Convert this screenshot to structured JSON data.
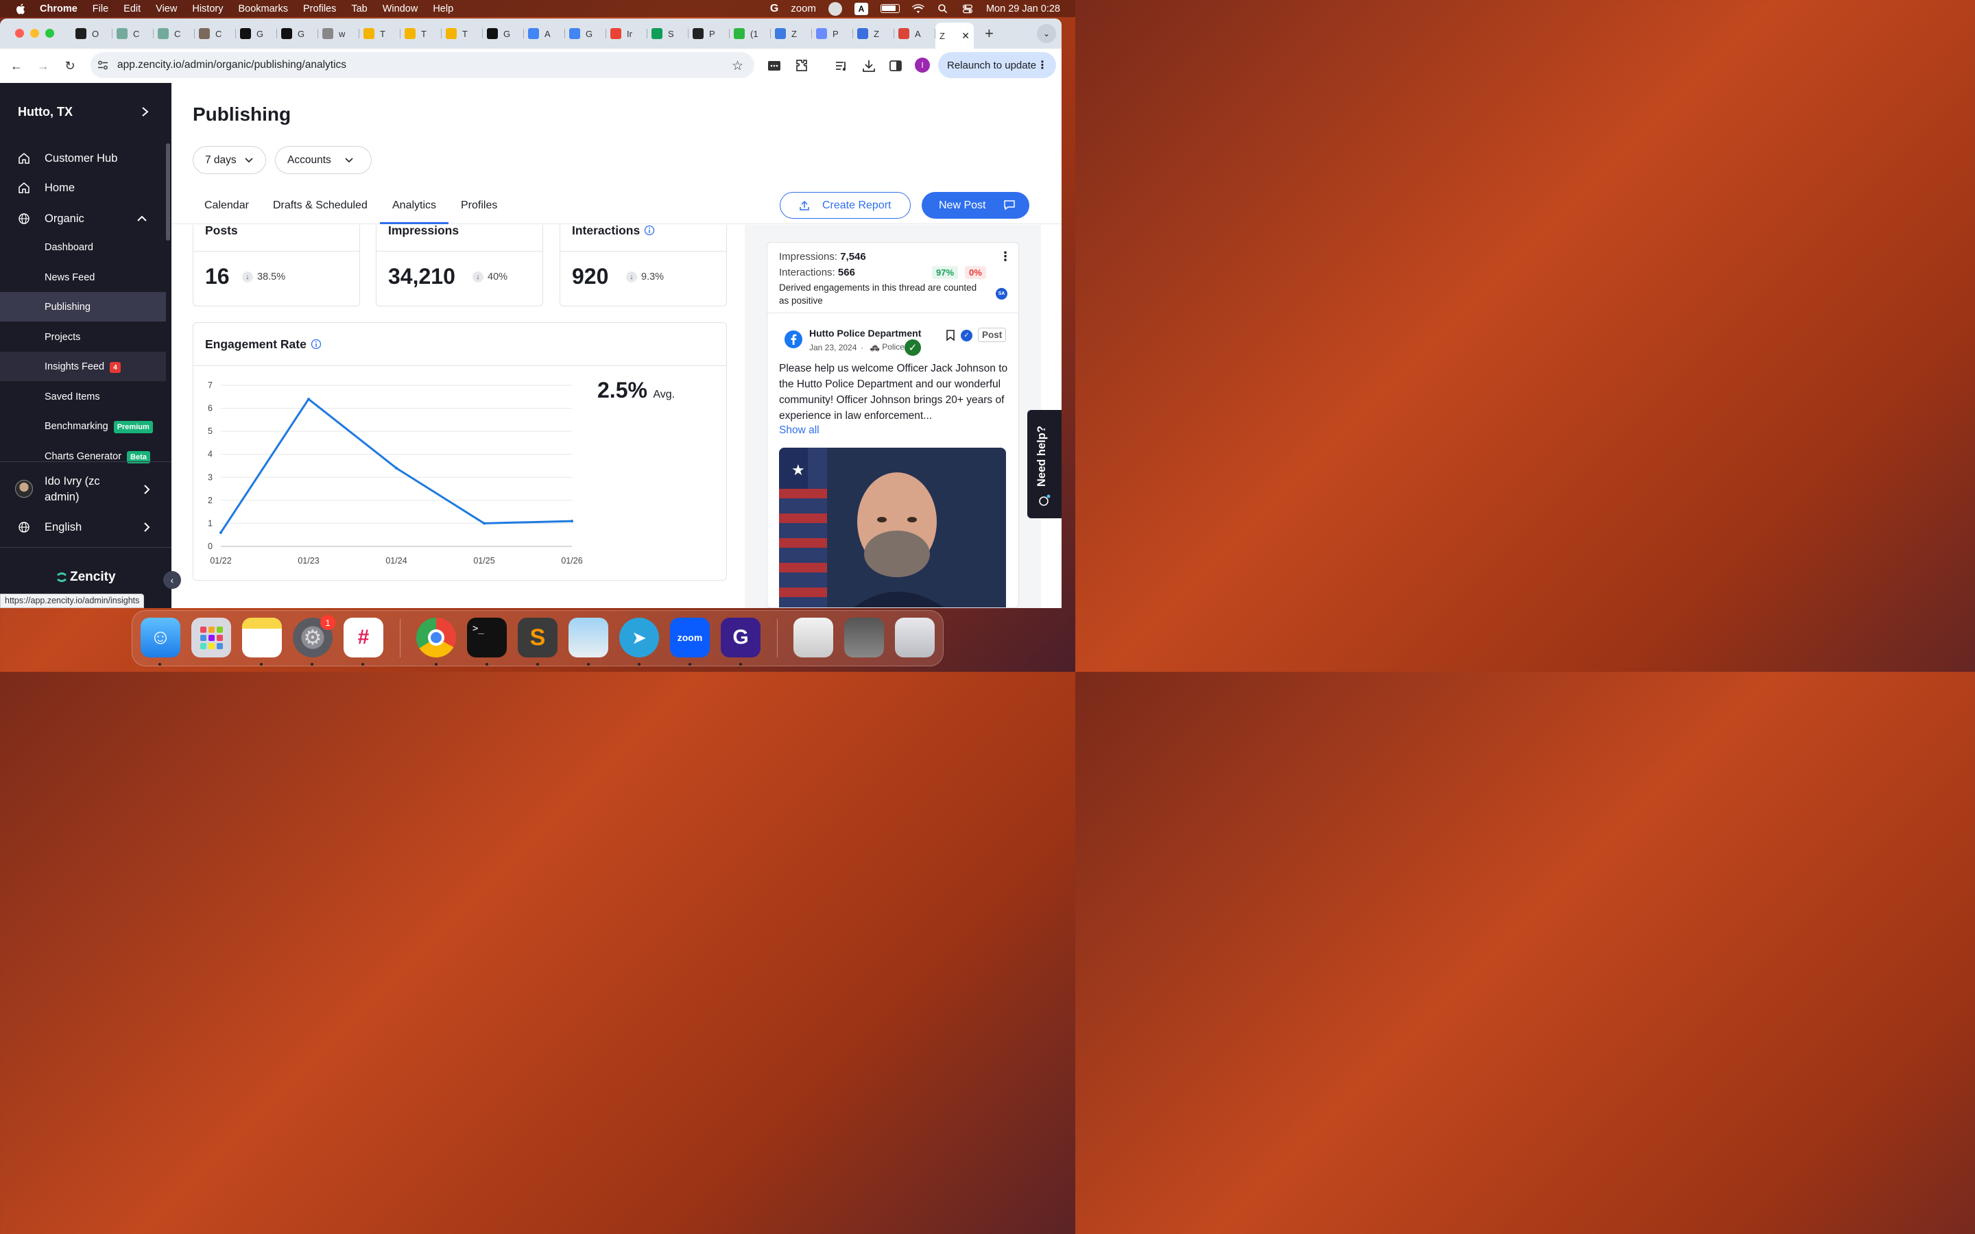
{
  "menubar": {
    "app": "Chrome",
    "items": [
      "File",
      "Edit",
      "View",
      "History",
      "Bookmarks",
      "Profiles",
      "Tab",
      "Window",
      "Help"
    ],
    "datetime": "Mon 29 Jan  0:28",
    "zoom_label": "zoom"
  },
  "browser": {
    "tabs": [
      {
        "letter": "O",
        "color": "#1f1f1f"
      },
      {
        "letter": "C",
        "color": "#74aa9c"
      },
      {
        "letter": "C",
        "color": "#74aa9c"
      },
      {
        "letter": "C",
        "color": "#7b6a5b"
      },
      {
        "letter": "G",
        "color": "#111111"
      },
      {
        "letter": "G",
        "color": "#111111"
      },
      {
        "letter": "w",
        "color": "#888888"
      },
      {
        "letter": "T",
        "color": "#f4b400"
      },
      {
        "letter": "T",
        "color": "#f4b400"
      },
      {
        "letter": "T",
        "color": "#f4b400"
      },
      {
        "letter": "G",
        "color": "#111111"
      },
      {
        "letter": "A",
        "color": "#4285f4"
      },
      {
        "letter": "G",
        "color": "#4285f4"
      },
      {
        "letter": "Ir",
        "color": "#ea4335"
      },
      {
        "letter": "S",
        "color": "#0f9d58"
      },
      {
        "letter": "P",
        "color": "#222222"
      },
      {
        "letter": "(1",
        "color": "#2cb742"
      },
      {
        "letter": "Z",
        "color": "#3d7be0"
      },
      {
        "letter": "P",
        "color": "#6b8cff"
      },
      {
        "letter": "Z",
        "color": "#3b6fe0"
      },
      {
        "letter": "A",
        "color": "#db4437"
      }
    ],
    "active_tab": {
      "letter": "Z"
    },
    "url": "app.zencity.io/admin/organic/publishing/analytics",
    "relaunch_label": "Relaunch to update",
    "profile_initial": "I",
    "status_url": "https://app.zencity.io/admin/insights"
  },
  "sidebar": {
    "location": "Hutto, TX",
    "items": [
      {
        "label": "Customer Hub",
        "icon": "home-icon"
      },
      {
        "label": "Home",
        "icon": "home-icon"
      },
      {
        "label": "Organic",
        "icon": "globe-icon"
      }
    ],
    "subitems": [
      {
        "label": "Dashboard"
      },
      {
        "label": "News Feed"
      },
      {
        "label": "Publishing"
      },
      {
        "label": "Projects"
      },
      {
        "label": "Insights Feed",
        "badge": "4"
      },
      {
        "label": "Saved Items"
      },
      {
        "label": "Benchmarking",
        "badge": "Premium"
      },
      {
        "label": "Charts Generator",
        "badge": "Beta"
      }
    ],
    "user": "Ido Ivry (zc admin)",
    "user_line1": "Ido Ivry (zc",
    "user_line2": "admin)",
    "language": "English",
    "brand": "Zencity"
  },
  "main": {
    "title": "Publishing",
    "filters": {
      "period": "7 days",
      "accounts": "Accounts"
    },
    "tabs": [
      "Calendar",
      "Drafts & Scheduled",
      "Analytics",
      "Profiles"
    ],
    "active_tab": "Analytics",
    "create_report": "Create Report",
    "new_post": "New Post",
    "stats": [
      {
        "title": "Posts",
        "value": "16",
        "delta": "38.5%"
      },
      {
        "title": "Impressions",
        "value": "34,210",
        "delta": "40%"
      },
      {
        "title": "Interactions",
        "value": "920",
        "delta": "9.3%"
      }
    ],
    "engagement": {
      "title": "Engagement Rate",
      "avg_value": "2.5%",
      "avg_label": "Avg."
    }
  },
  "chart_data": {
    "type": "line",
    "title": "Engagement Rate",
    "x": [
      "01/22",
      "01/23",
      "01/24",
      "01/25",
      "01/26"
    ],
    "values": [
      0.6,
      6.4,
      3.4,
      1.0,
      1.1
    ],
    "ylim": [
      0,
      7
    ],
    "yticks": [
      0,
      1,
      2,
      3,
      4,
      5,
      6,
      7
    ],
    "grid": true,
    "color": "#1f7ae0"
  },
  "post": {
    "impressions_label": "Impressions:",
    "impressions_value": "7,546",
    "interactions_label": "Interactions:",
    "interactions_value": "566",
    "positive_pct": "97%",
    "negative_pct": "0%",
    "note": "Derived engagements in this thread are counted as positive",
    "avatar_initials": "SA",
    "author": "Hutto Police Department",
    "date": "Jan 23, 2024",
    "tag": "Police",
    "type_label": "Post",
    "text": "Please help us welcome Officer Jack Johnson to the Hutto Police Department and our wonderful community! Officer Johnson brings 20+ years of experience in law enforcement...",
    "show_all": "Show all"
  },
  "need_help": "Need help?",
  "dock": {
    "notification_count": "1",
    "zoom_label": "zoom"
  }
}
